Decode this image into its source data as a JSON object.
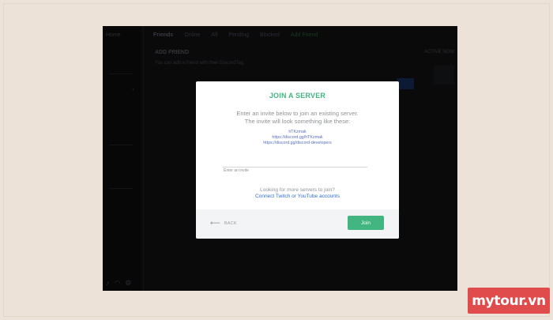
{
  "app": {
    "channel_header": "Home",
    "topbar": {
      "friends": "Friends",
      "tabs": [
        "Online",
        "All",
        "Pending",
        "Blocked"
      ],
      "add_friend_tab": "Add Friend"
    },
    "add_friend": {
      "title": "ADD FRIEND",
      "subtitle": "You can add a friend with their DiscordTag."
    },
    "active_now": "ACTIVE NOW"
  },
  "modal": {
    "title": "JOIN A SERVER",
    "description": [
      "Enter an invite below to join an existing server.",
      "The invite will look something like these:"
    ],
    "examples": [
      "hTKzmak",
      "https://discord.gg/hTKzmak",
      "https://discord.gg/discord-developers"
    ],
    "input_label": "Enter an invite",
    "input_value": "",
    "more_text": "Looking for more servers to join?",
    "more_link": "Connect Twitch or YouTube accounts",
    "back_label": "BACK",
    "join_label": "Join"
  },
  "brand": {
    "text": "mytour.vn"
  },
  "colors": {
    "accent_green": "#43b581",
    "link_blue": "#2f6fd6",
    "brand_red": "#e04c4c"
  }
}
